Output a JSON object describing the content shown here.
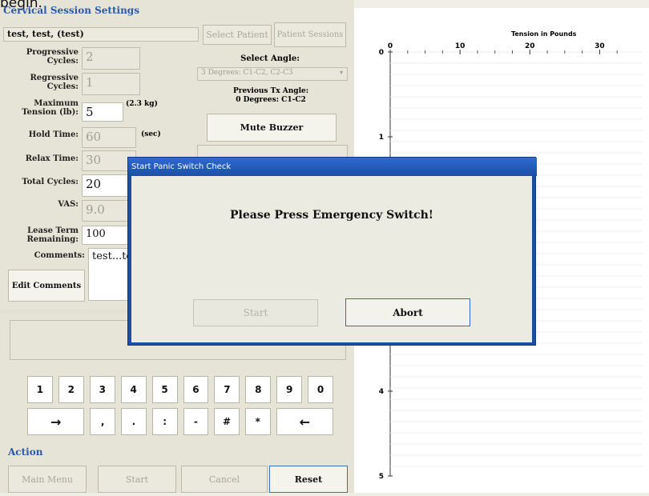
{
  "header_partial": "begin.",
  "section_title": "Cervical Session Settings",
  "patient": {
    "name": "test, test, (test)",
    "select_patient": "Select Patient",
    "patient_sessions": "Patient Sessions"
  },
  "fields": {
    "progressive_cycles": {
      "label": "Progressive Cycles:",
      "value": "2"
    },
    "regressive_cycles": {
      "label": "Regressive Cycles:",
      "value": "1"
    },
    "max_tension": {
      "label": "Maximum Tension (lb):",
      "value": "5",
      "unit": "(2.3 kg)"
    },
    "hold_time": {
      "label": "Hold Time:",
      "value": "60",
      "unit": "(sec)"
    },
    "relax_time": {
      "label": "Relax Time:",
      "value": "30"
    },
    "total_cycles": {
      "label": "Total Cycles:",
      "value": "20"
    },
    "vas": {
      "label": "VAS:",
      "value": "9.0"
    },
    "lease_term": {
      "label": "Lease Term Remaining:",
      "value": "100"
    },
    "comments": {
      "label": "Comments:",
      "value": "test...te"
    }
  },
  "angle": {
    "label": "Select Angle:",
    "selected": "3 Degrees: C1-C2, C2-C3",
    "previous_label": "Previous Tx Angle:",
    "previous_value": "0 Degrees: C1-C2"
  },
  "mute_buzzer": "Mute Buzzer",
  "edit_comments": "Edit Comments",
  "keypad": {
    "row1": [
      "1",
      "2",
      "3",
      "4",
      "5",
      "6",
      "7",
      "8",
      "9",
      "0"
    ],
    "row2": [
      "→",
      ",",
      ".",
      ":",
      "-",
      "#",
      "*",
      "←"
    ]
  },
  "action": {
    "label": "Action",
    "main_menu": "Main Menu",
    "start": "Start",
    "cancel": "Cancel",
    "reset": "Reset"
  },
  "chart_data": {
    "type": "line",
    "title": "Tension in Pounds",
    "x_ticks": [
      "0",
      "10",
      "20",
      "30"
    ],
    "y_ticks": [
      "0",
      "1",
      "4",
      "5"
    ],
    "series": []
  },
  "dialog": {
    "title": "Start Panic Switch Check",
    "message": "Please Press Emergency Switch!",
    "start": "Start",
    "abort": "Abort"
  },
  "colors": {
    "accent": "#2a5aa8",
    "dialog_title": "#1c4fa0"
  }
}
